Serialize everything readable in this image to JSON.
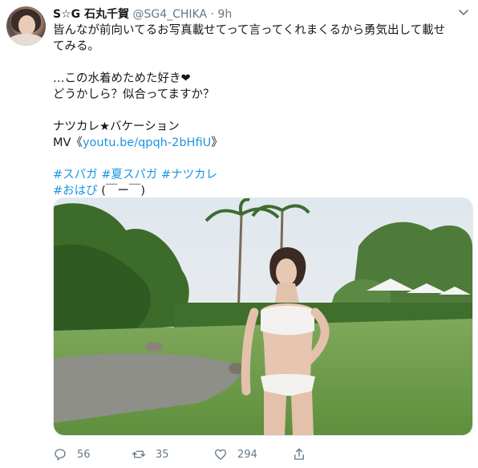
{
  "tweet": {
    "display_name": "S☆G 石丸千賀",
    "handle": "@SG4_CHIKA",
    "separator": "·",
    "time": "9h",
    "lines": [
      "皆んなが前向いてるお写真載せてって言ってくれまくるから勇気出して載せ",
      "てみる。",
      "",
      "…この水着めためた好き❤",
      "どうかしら？似合ってますか？",
      "",
      "ナツカレ★バケーション"
    ],
    "mv_prefix": "MV《",
    "mv_link": "youtu.be/qpqh-2bHfiU",
    "mv_suffix": "》",
    "hashtags": [
      "#スパガ",
      "#夏スパガ",
      "#ナツカレ"
    ],
    "hashtag2": "#おはぴ",
    "kaomoji": " (￣ー￣)",
    "media_icons": [
      "tree-icon"
    ],
    "replies": "56",
    "retweets": "35",
    "likes": "294"
  },
  "colors": {
    "link": "#1b95e0",
    "secondary": "#657786",
    "text": "#14171a"
  }
}
